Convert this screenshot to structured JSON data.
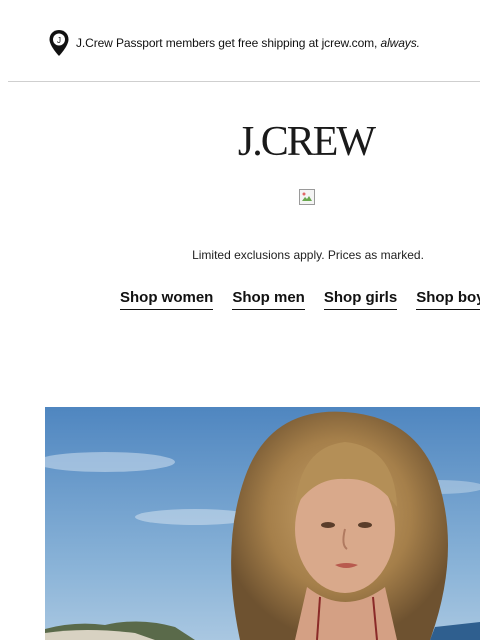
{
  "promo": {
    "text": "J.Crew Passport members get free shipping at jcrew.com, ",
    "emphasis": "always."
  },
  "brand": {
    "logo_text": "J.CREW"
  },
  "disclaimer": "Limited exclusions apply. Prices as marked.",
  "shop_nav": [
    {
      "label": "Shop women"
    },
    {
      "label": "Shop men"
    },
    {
      "label": "Shop girls"
    },
    {
      "label": "Shop boys"
    }
  ],
  "icons": {
    "promo": "location-pin-icon",
    "missing_image": "broken-image-icon"
  },
  "colors": {
    "sky": "#5b8fc4",
    "hair": "#b08c58",
    "skin": "#d7a88a"
  }
}
